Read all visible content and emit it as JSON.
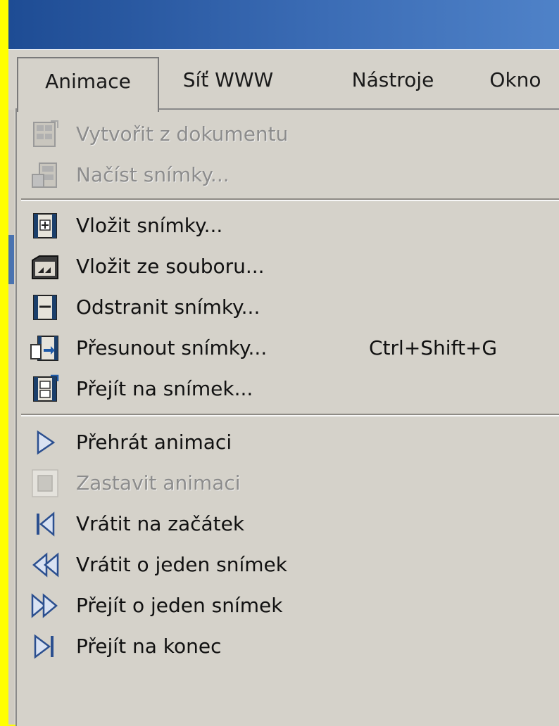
{
  "menubar": {
    "items": [
      "Animace",
      "Síť WWW",
      "Nástroje",
      "Okno"
    ]
  },
  "dropdown": {
    "items": [
      {
        "label": "Vytvořit z dokumentu",
        "disabled": true,
        "icon": "create-from-document-icon"
      },
      {
        "label": "Načíst snímky...",
        "disabled": true,
        "icon": "load-frames-icon"
      },
      {
        "label": "Vložit snímky...",
        "disabled": false,
        "icon": "insert-frames-icon"
      },
      {
        "label": "Vložit ze souboru...",
        "disabled": false,
        "icon": "insert-from-file-icon"
      },
      {
        "label": "Odstranit snímky...",
        "disabled": false,
        "icon": "delete-frames-icon"
      },
      {
        "label": "Přesunout snímky...",
        "disabled": false,
        "icon": "move-frames-icon",
        "shortcut": "Ctrl+Shift+G"
      },
      {
        "label": "Přejít na snímek...",
        "disabled": false,
        "icon": "go-to-frame-icon"
      },
      {
        "label": "Přehrát animaci",
        "disabled": false,
        "icon": "play-icon"
      },
      {
        "label": "Zastavit animaci",
        "disabled": true,
        "icon": "stop-icon"
      },
      {
        "label": "Vrátit na začátek",
        "disabled": false,
        "icon": "rewind-to-start-icon"
      },
      {
        "label": "Vrátit o jeden snímek",
        "disabled": false,
        "icon": "step-back-icon"
      },
      {
        "label": "Přejít o jeden snímek",
        "disabled": false,
        "icon": "step-forward-icon"
      },
      {
        "label": "Přejít na konec",
        "disabled": false,
        "icon": "go-to-end-icon"
      }
    ]
  },
  "colors": {
    "menu_background": "#D5D2CA",
    "title_bar": "#2A5AA0",
    "disabled_text": "#8C8C8C",
    "outer_background": "#FFFF00"
  }
}
